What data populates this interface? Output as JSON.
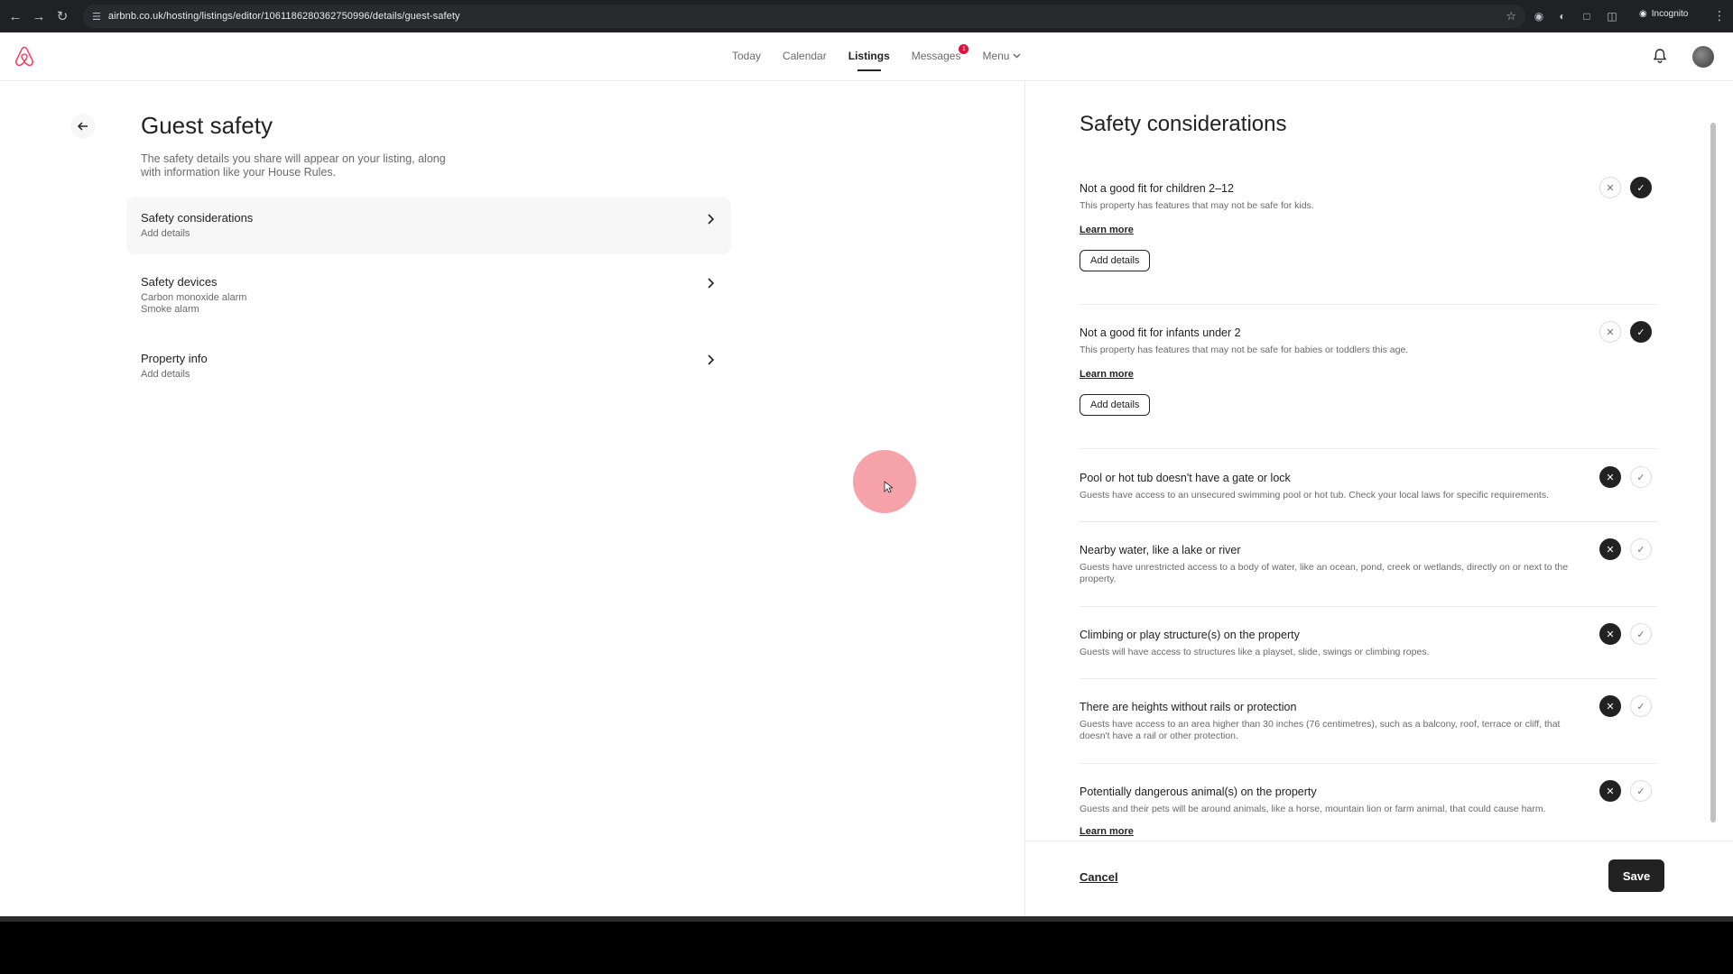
{
  "browser": {
    "url": "airbnb.co.uk/hosting/listings/editor/1061186280362750996/details/guest-safety",
    "incognito_label": "Incognito"
  },
  "nav": {
    "links": [
      "Today",
      "Calendar",
      "Listings",
      "Messages"
    ],
    "active": "Listings",
    "messages_badge": "1",
    "menu_label": "Menu"
  },
  "left": {
    "title": "Guest safety",
    "subtitle": "The safety details you share will appear on your listing, along with information like your House Rules.",
    "rows": [
      {
        "title": "Safety considerations",
        "sub": [
          "Add details"
        ]
      },
      {
        "title": "Safety devices",
        "sub": [
          "Carbon monoxide alarm",
          "Smoke alarm"
        ]
      },
      {
        "title": "Property info",
        "sub": [
          "Add details"
        ]
      }
    ]
  },
  "right": {
    "title": "Safety considerations",
    "items": [
      {
        "title": "Not a good fit for children 2–12",
        "desc": "This property has features that may not be safe for kids.",
        "learn_more": "Learn more",
        "add_details": "Add details",
        "state": "yes"
      },
      {
        "title": "Not a good fit for infants under 2",
        "desc": "This property has features that may not be safe for babies or toddlers this age.",
        "learn_more": "Learn more",
        "add_details": "Add details",
        "state": "yes"
      },
      {
        "title": "Pool or hot tub doesn't have a gate or lock",
        "desc": "Guests have access to an unsecured swimming pool or hot tub. Check your local laws for specific requirements.",
        "state": "no"
      },
      {
        "title": "Nearby water, like a lake or river",
        "desc": "Guests have unrestricted access to a body of water, like an ocean, pond, creek or wetlands, directly on or next to the property.",
        "state": "no"
      },
      {
        "title": "Climbing or play structure(s) on the property",
        "desc": "Guests will have access to structures like a playset, slide, swings or climbing ropes.",
        "state": "no"
      },
      {
        "title": "There are heights without rails or protection",
        "desc": "Guests have access to an area higher than 30 inches (76 centimetres), such as a balcony, roof, terrace or cliff, that doesn't have a rail or other protection.",
        "state": "no"
      },
      {
        "title": "Potentially dangerous animal(s) on the property",
        "desc": "Guests and their pets will be around animals, like a horse, mountain lion or farm animal, that could cause harm.",
        "learn_more": "Learn more",
        "state": "no"
      }
    ],
    "cancel_label": "Cancel",
    "save_label": "Save"
  },
  "icons": [
    "back-arrow-icon",
    "forward-arrow-icon",
    "reload-icon",
    "site-info-icon",
    "bookmark-star-icon",
    "airbnb-logo-icon",
    "chevron-down-icon",
    "bell-icon",
    "chevron-right-icon",
    "close-icon",
    "check-icon",
    "cursor-icon"
  ],
  "colors": {
    "brand": "#ff385c",
    "badge": "#e0103e",
    "dark": "#222222",
    "muted": "#6a6a6a"
  }
}
